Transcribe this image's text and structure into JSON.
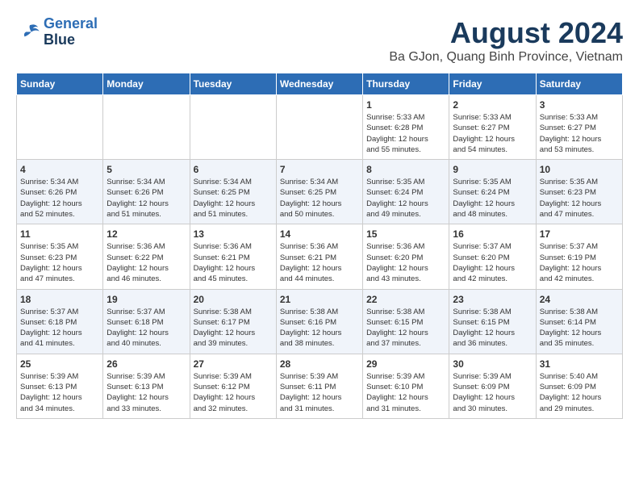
{
  "header": {
    "logo_line1": "General",
    "logo_line2": "Blue",
    "month": "August 2024",
    "location": "Ba GJon, Quang Binh Province, Vietnam"
  },
  "days_of_week": [
    "Sunday",
    "Monday",
    "Tuesday",
    "Wednesday",
    "Thursday",
    "Friday",
    "Saturday"
  ],
  "weeks": [
    [
      {
        "num": "",
        "info": ""
      },
      {
        "num": "",
        "info": ""
      },
      {
        "num": "",
        "info": ""
      },
      {
        "num": "",
        "info": ""
      },
      {
        "num": "1",
        "info": "Sunrise: 5:33 AM\nSunset: 6:28 PM\nDaylight: 12 hours\nand 55 minutes."
      },
      {
        "num": "2",
        "info": "Sunrise: 5:33 AM\nSunset: 6:27 PM\nDaylight: 12 hours\nand 54 minutes."
      },
      {
        "num": "3",
        "info": "Sunrise: 5:33 AM\nSunset: 6:27 PM\nDaylight: 12 hours\nand 53 minutes."
      }
    ],
    [
      {
        "num": "4",
        "info": "Sunrise: 5:34 AM\nSunset: 6:26 PM\nDaylight: 12 hours\nand 52 minutes."
      },
      {
        "num": "5",
        "info": "Sunrise: 5:34 AM\nSunset: 6:26 PM\nDaylight: 12 hours\nand 51 minutes."
      },
      {
        "num": "6",
        "info": "Sunrise: 5:34 AM\nSunset: 6:25 PM\nDaylight: 12 hours\nand 51 minutes."
      },
      {
        "num": "7",
        "info": "Sunrise: 5:34 AM\nSunset: 6:25 PM\nDaylight: 12 hours\nand 50 minutes."
      },
      {
        "num": "8",
        "info": "Sunrise: 5:35 AM\nSunset: 6:24 PM\nDaylight: 12 hours\nand 49 minutes."
      },
      {
        "num": "9",
        "info": "Sunrise: 5:35 AM\nSunset: 6:24 PM\nDaylight: 12 hours\nand 48 minutes."
      },
      {
        "num": "10",
        "info": "Sunrise: 5:35 AM\nSunset: 6:23 PM\nDaylight: 12 hours\nand 47 minutes."
      }
    ],
    [
      {
        "num": "11",
        "info": "Sunrise: 5:35 AM\nSunset: 6:23 PM\nDaylight: 12 hours\nand 47 minutes."
      },
      {
        "num": "12",
        "info": "Sunrise: 5:36 AM\nSunset: 6:22 PM\nDaylight: 12 hours\nand 46 minutes."
      },
      {
        "num": "13",
        "info": "Sunrise: 5:36 AM\nSunset: 6:21 PM\nDaylight: 12 hours\nand 45 minutes."
      },
      {
        "num": "14",
        "info": "Sunrise: 5:36 AM\nSunset: 6:21 PM\nDaylight: 12 hours\nand 44 minutes."
      },
      {
        "num": "15",
        "info": "Sunrise: 5:36 AM\nSunset: 6:20 PM\nDaylight: 12 hours\nand 43 minutes."
      },
      {
        "num": "16",
        "info": "Sunrise: 5:37 AM\nSunset: 6:20 PM\nDaylight: 12 hours\nand 42 minutes."
      },
      {
        "num": "17",
        "info": "Sunrise: 5:37 AM\nSunset: 6:19 PM\nDaylight: 12 hours\nand 42 minutes."
      }
    ],
    [
      {
        "num": "18",
        "info": "Sunrise: 5:37 AM\nSunset: 6:18 PM\nDaylight: 12 hours\nand 41 minutes."
      },
      {
        "num": "19",
        "info": "Sunrise: 5:37 AM\nSunset: 6:18 PM\nDaylight: 12 hours\nand 40 minutes."
      },
      {
        "num": "20",
        "info": "Sunrise: 5:38 AM\nSunset: 6:17 PM\nDaylight: 12 hours\nand 39 minutes."
      },
      {
        "num": "21",
        "info": "Sunrise: 5:38 AM\nSunset: 6:16 PM\nDaylight: 12 hours\nand 38 minutes."
      },
      {
        "num": "22",
        "info": "Sunrise: 5:38 AM\nSunset: 6:15 PM\nDaylight: 12 hours\nand 37 minutes."
      },
      {
        "num": "23",
        "info": "Sunrise: 5:38 AM\nSunset: 6:15 PM\nDaylight: 12 hours\nand 36 minutes."
      },
      {
        "num": "24",
        "info": "Sunrise: 5:38 AM\nSunset: 6:14 PM\nDaylight: 12 hours\nand 35 minutes."
      }
    ],
    [
      {
        "num": "25",
        "info": "Sunrise: 5:39 AM\nSunset: 6:13 PM\nDaylight: 12 hours\nand 34 minutes."
      },
      {
        "num": "26",
        "info": "Sunrise: 5:39 AM\nSunset: 6:13 PM\nDaylight: 12 hours\nand 33 minutes."
      },
      {
        "num": "27",
        "info": "Sunrise: 5:39 AM\nSunset: 6:12 PM\nDaylight: 12 hours\nand 32 minutes."
      },
      {
        "num": "28",
        "info": "Sunrise: 5:39 AM\nSunset: 6:11 PM\nDaylight: 12 hours\nand 31 minutes."
      },
      {
        "num": "29",
        "info": "Sunrise: 5:39 AM\nSunset: 6:10 PM\nDaylight: 12 hours\nand 31 minutes."
      },
      {
        "num": "30",
        "info": "Sunrise: 5:39 AM\nSunset: 6:09 PM\nDaylight: 12 hours\nand 30 minutes."
      },
      {
        "num": "31",
        "info": "Sunrise: 5:40 AM\nSunset: 6:09 PM\nDaylight: 12 hours\nand 29 minutes."
      }
    ]
  ]
}
